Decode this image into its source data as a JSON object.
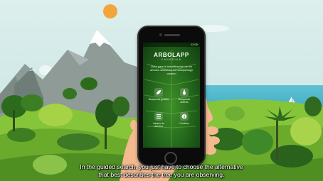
{
  "app": {
    "title": "ARBOLAPP",
    "subtitle": "CANARIAS",
    "status_time": "12:00",
    "description": "Guía para la identificación de los árboles silvestres del archipiélago canario",
    "menu": [
      {
        "label": "Búsqueda guiada",
        "icon": "leaf-icon"
      },
      {
        "label": "Búsqueda abierta",
        "icon": "footprint-icon"
      },
      {
        "label": "Listado de árboles",
        "icon": "list-icon"
      },
      {
        "label": "Créditos",
        "icon": "info-icon"
      }
    ]
  },
  "caption": {
    "line1": "In the guided search, you just have to choose the alternative",
    "line2": "that best describes the tree you are observing."
  },
  "colors": {
    "sky": "#cfe6e4",
    "sea": "#4eb7cb",
    "grass": "#7bbf34",
    "forest": "#2f6e1d",
    "mountain": "#8d9a95",
    "sun": "#f2a63a",
    "skin": "#f3b98f"
  }
}
